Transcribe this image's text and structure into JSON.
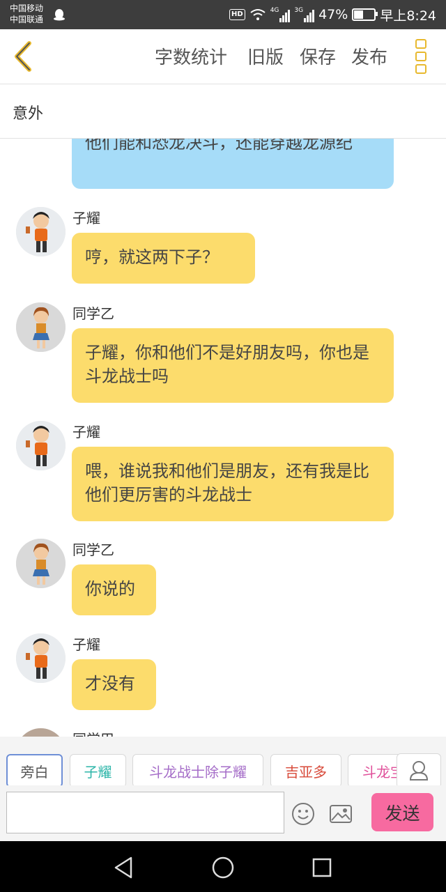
{
  "status_bar": {
    "carrier_1": "中国移动",
    "carrier_2": "中国联通",
    "hd": "HD",
    "net1": "4G",
    "net2": "3G",
    "battery_pct": "47%",
    "battery_level": 0.47,
    "time": "早上8:24"
  },
  "toolbar": {
    "word_count": "字数统计",
    "old_version": "旧版",
    "save": "保存",
    "publish": "发布"
  },
  "chapter_title": "意外",
  "messages": [
    {
      "text": "他们能和恐龙决斗，还能穿越龙源纪",
      "color": "#a6dcf8"
    },
    {
      "speaker": "子耀",
      "text": "哼，就这两下子？"
    },
    {
      "speaker": "同学乙",
      "text": "子耀，你和他们不是好朋友吗，你也是斗龙战士吗"
    },
    {
      "speaker": "子耀",
      "text": "喂，谁说我和他们是朋友，还有我是比他们更厉害的斗龙战士"
    },
    {
      "speaker": "同学乙",
      "text": "你说的"
    },
    {
      "speaker": "子耀",
      "text": "才没有"
    },
    {
      "speaker": "同学甲"
    }
  ],
  "roles": [
    {
      "label": "旁白",
      "color": "#555555"
    },
    {
      "label": "子耀",
      "color": "#2bb5a8"
    },
    {
      "label": "斗龙战士除子耀",
      "color": "#a56dc8"
    },
    {
      "label": "吉亚多",
      "color": "#d84a3a"
    },
    {
      "label": "斗龙宝",
      "color": "#e0509a"
    }
  ],
  "input": {
    "placeholder": ""
  },
  "send_label": "发送"
}
